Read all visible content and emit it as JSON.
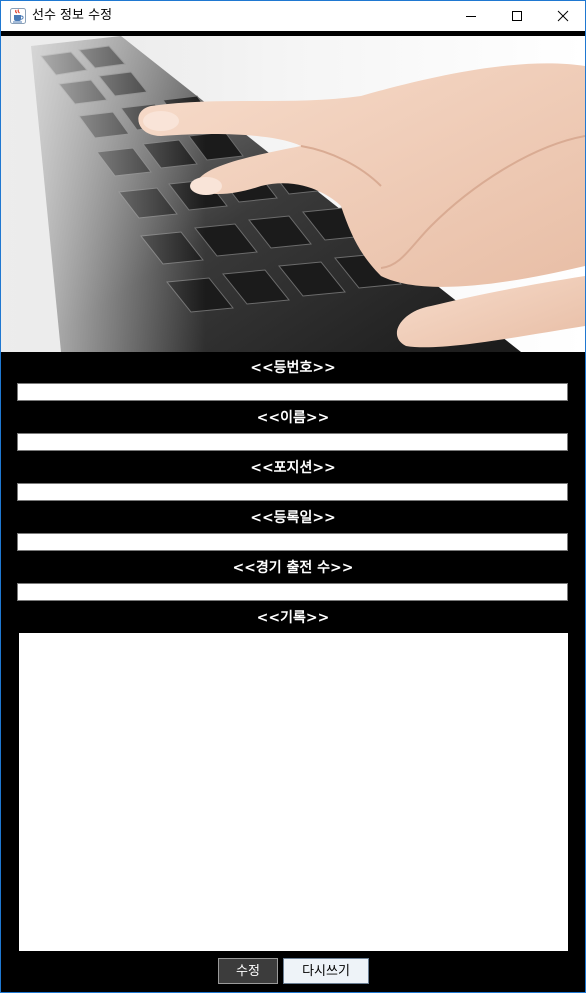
{
  "window": {
    "title": "선수 정보 수정",
    "icon": "java-cup-icon",
    "controls": [
      "minimize-icon",
      "maximize-icon",
      "close-icon"
    ]
  },
  "hero": {
    "image": "keyboard-typing-photo"
  },
  "form": {
    "fields": [
      {
        "label": "<<등번호>>",
        "value": ""
      },
      {
        "label": "<<이름>>",
        "value": ""
      },
      {
        "label": "<<포지션>>",
        "value": ""
      },
      {
        "label": "<<등록일>>",
        "value": ""
      },
      {
        "label": "<<경기 출전 수>>",
        "value": ""
      }
    ],
    "record": {
      "label": "<<기록>>",
      "value": ""
    }
  },
  "buttons": {
    "edit": "수정",
    "reset": "다시쓰기"
  },
  "colors": {
    "background": "#000000",
    "label": "#ffffff",
    "edit_button": "#3c3c3c",
    "reset_button": "#eef3f8",
    "window_border": "#1f78d1"
  }
}
